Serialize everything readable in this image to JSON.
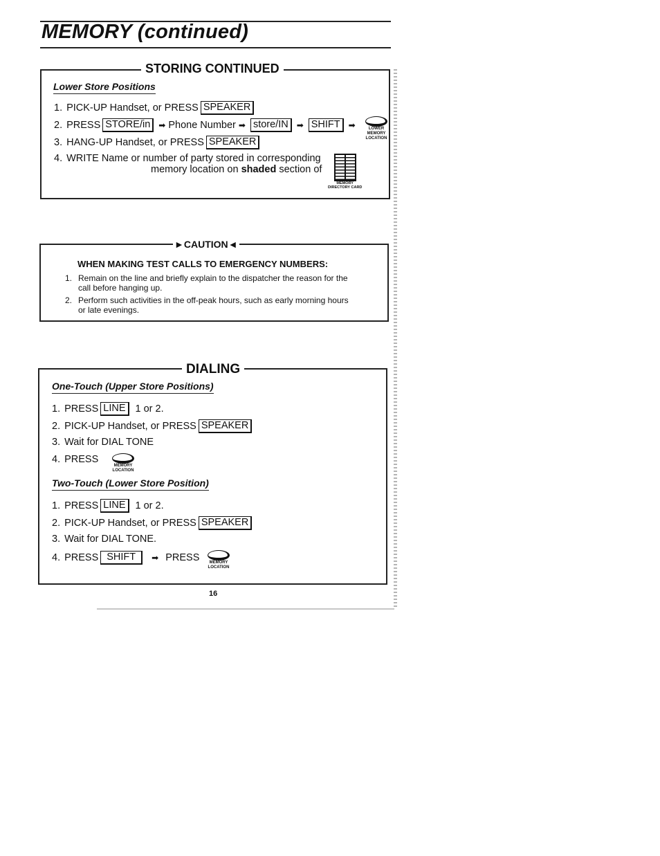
{
  "page": {
    "title": "MEMORY (continued)",
    "page_number": "16"
  },
  "storing": {
    "heading": "STORING CONTINUED",
    "subheading": "Lower Store Positions",
    "step1": {
      "num": "1.",
      "text": "PICK-UP Handset, or PRESS",
      "key": "SPEAKER"
    },
    "step2": {
      "num": "2.",
      "press": "PRESS",
      "key1": "STORE/in",
      "arrow": "➡",
      "phone": "Phone Number",
      "key2": "store/IN",
      "key3": "SHIFT",
      "icon_caption_1": "LOWER",
      "icon_caption_2": "MEMORY",
      "icon_caption_3": "LOCATION"
    },
    "step3": {
      "num": "3.",
      "text": "HANG-UP Handset, or PRESS",
      "key": "SPEAKER"
    },
    "step4": {
      "num": "4.",
      "line1": "WRITE Name or number of party stored in corresponding",
      "line2_pre": "memory location on",
      "line2_bold": "shaded",
      "line2_post": "section of",
      "card_caption_1": "MEMORY",
      "card_caption_2": "DIRECTORY CARD"
    }
  },
  "caution": {
    "heading": "CAUTION",
    "arrow_left": "►",
    "arrow_right": "◄",
    "subheading": "WHEN MAKING TEST CALLS TO EMERGENCY NUMBERS:",
    "items": [
      {
        "num": "1.",
        "line1": "Remain on the line and briefly explain to the dispatcher the reason for the",
        "line2": "call before hanging up."
      },
      {
        "num": "2.",
        "line1": "Perform such activities in the off-peak hours, such as early morning hours",
        "line2": "or late evenings."
      }
    ]
  },
  "dialing": {
    "heading": "DIALING",
    "one_touch": {
      "subheading": "One-Touch (Upper Store Positions)",
      "step1": {
        "num": "1.",
        "press": "PRESS",
        "key": "LINE",
        "suffix": "1 or 2."
      },
      "step2": {
        "num": "2.",
        "text": "PICK-UP Handset, or PRESS",
        "key": "SPEAKER"
      },
      "step3": {
        "num": "3.",
        "text": "Wait for DIAL TONE"
      },
      "step4": {
        "num": "4.",
        "press": "PRESS",
        "icon_caption_1": "MEMORY",
        "icon_caption_2": "LOCATION"
      }
    },
    "two_touch": {
      "subheading": "Two-Touch (Lower Store Position)",
      "step1": {
        "num": "1.",
        "press": "PRESS",
        "key": "LINE",
        "suffix": "1 or 2."
      },
      "step2": {
        "num": "2.",
        "text": "PICK-UP Handset, or PRESS",
        "key": "SPEAKER"
      },
      "step3": {
        "num": "3.",
        "text": "Wait for DIAL TONE."
      },
      "step4": {
        "num": "4.",
        "press": "PRESS",
        "key": "SHIFT",
        "arrow": "➡",
        "press2": "PRESS",
        "icon_caption_1": "MEMORY",
        "icon_caption_2": "LOCATION"
      }
    }
  }
}
